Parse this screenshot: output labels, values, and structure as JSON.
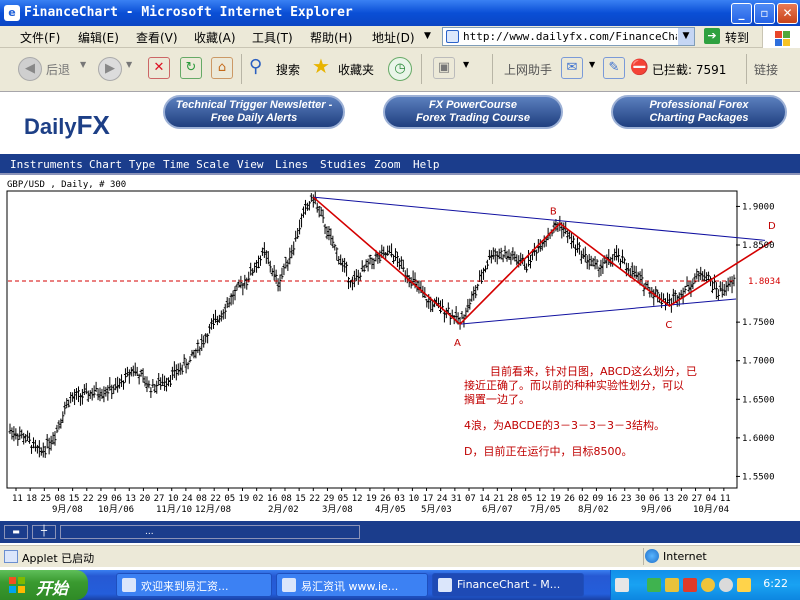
{
  "window": {
    "title": "FinanceChart - Microsoft Internet Explorer",
    "app_icon": "e"
  },
  "menu": {
    "items": [
      "文件(F)",
      "编辑(E)",
      "查看(V)",
      "收藏(A)",
      "工具(T)",
      "帮助(H)"
    ],
    "address_label": "地址(D)",
    "url": "http://www.dailyfx.com/FinanceChart.",
    "go_label": "转到"
  },
  "toolbar": {
    "back_label": "后退",
    "search_label": "搜索",
    "favorites_label": "收藏夹",
    "online_helper_label": "上网助手",
    "blocked_label": "已拦截: 7591",
    "links_label": "链接"
  },
  "banner": {
    "logo_a": "Daily",
    "logo_b": "FX",
    "buttons": [
      {
        "line1": "Technical Trigger Newsletter -",
        "line2": "Free Daily Alerts"
      },
      {
        "line1": "FX PowerCourse",
        "line2": "Forex Trading Course"
      },
      {
        "line1": "Professional Forex",
        "line2": "Charting Packages"
      }
    ]
  },
  "app_menu": [
    "Instruments",
    "Chart Type",
    "Time Scale",
    "View",
    "Lines",
    "Studies",
    "Zoom",
    "Help"
  ],
  "chart_data": {
    "type": "ohlc",
    "symbol_label": "GBP/USD , Daily, # 300",
    "y_ticks": [
      1.9,
      1.85,
      1.75,
      1.7,
      1.65,
      1.6,
      1.55
    ],
    "ylim": [
      1.535,
      1.92
    ],
    "current_price": "1.8034",
    "x_day_labels": [
      "11",
      "18",
      "25",
      "08",
      "15",
      "22",
      "29",
      "06",
      "13",
      "20",
      "27",
      "10",
      "24",
      "08",
      "22",
      "05",
      "19",
      "02",
      "16",
      "08",
      "15",
      "22",
      "29",
      "05",
      "12",
      "19",
      "26",
      "03",
      "10",
      "17",
      "24",
      "31",
      "07",
      "14",
      "21",
      "28",
      "05",
      "12",
      "19",
      "26",
      "02",
      "09",
      "16",
      "23",
      "30",
      "06",
      "13",
      "20",
      "27",
      "04",
      "11"
    ],
    "x_month_labels": [
      "9月/08",
      "10月/06",
      "11月/10",
      "12月/08",
      "2月/02",
      "3月/08",
      "4月/05",
      "5月/03",
      "6月/07",
      "7月/05",
      "8月/02",
      "9月/06",
      "10月/04"
    ],
    "pattern": [
      {
        "label": "A",
        "price": 1.7475
      },
      {
        "label": "B",
        "price": 1.878
      },
      {
        "label": "C",
        "price": 1.771
      },
      {
        "label": "D",
        "price": 1.855
      }
    ],
    "pattern_start_price": 1.912,
    "channel_upper": {
      "start": 1.912,
      "end": 1.856
    },
    "channel_lower": {
      "start": 1.7475,
      "end": 1.78
    }
  },
  "annotation": {
    "line1": "目前看来，针对日图，ABCD这么划分，已",
    "line2": "接近正确了。而以前的种种实验性划分，可以",
    "line3": "搁置一边了。",
    "line4": "4浪，为ABCDE的3－3－3－3－3结构。",
    "line5": "D，目前正在运行中，目标8500。"
  },
  "applet_bar": {
    "ellipsis": "..."
  },
  "status": {
    "left": "Applet 已启动",
    "zone": "Internet"
  },
  "taskbar": {
    "start_label": "开始",
    "tasks": [
      "欢迎来到易汇资...",
      "易汇资讯 www.ie...",
      "FinanceChart - M..."
    ],
    "clock": "6:22"
  },
  "colors": {
    "accent_blue": "#1b3d8c",
    "pattern_red": "#d40000",
    "channel_blue": "#1010a0"
  }
}
